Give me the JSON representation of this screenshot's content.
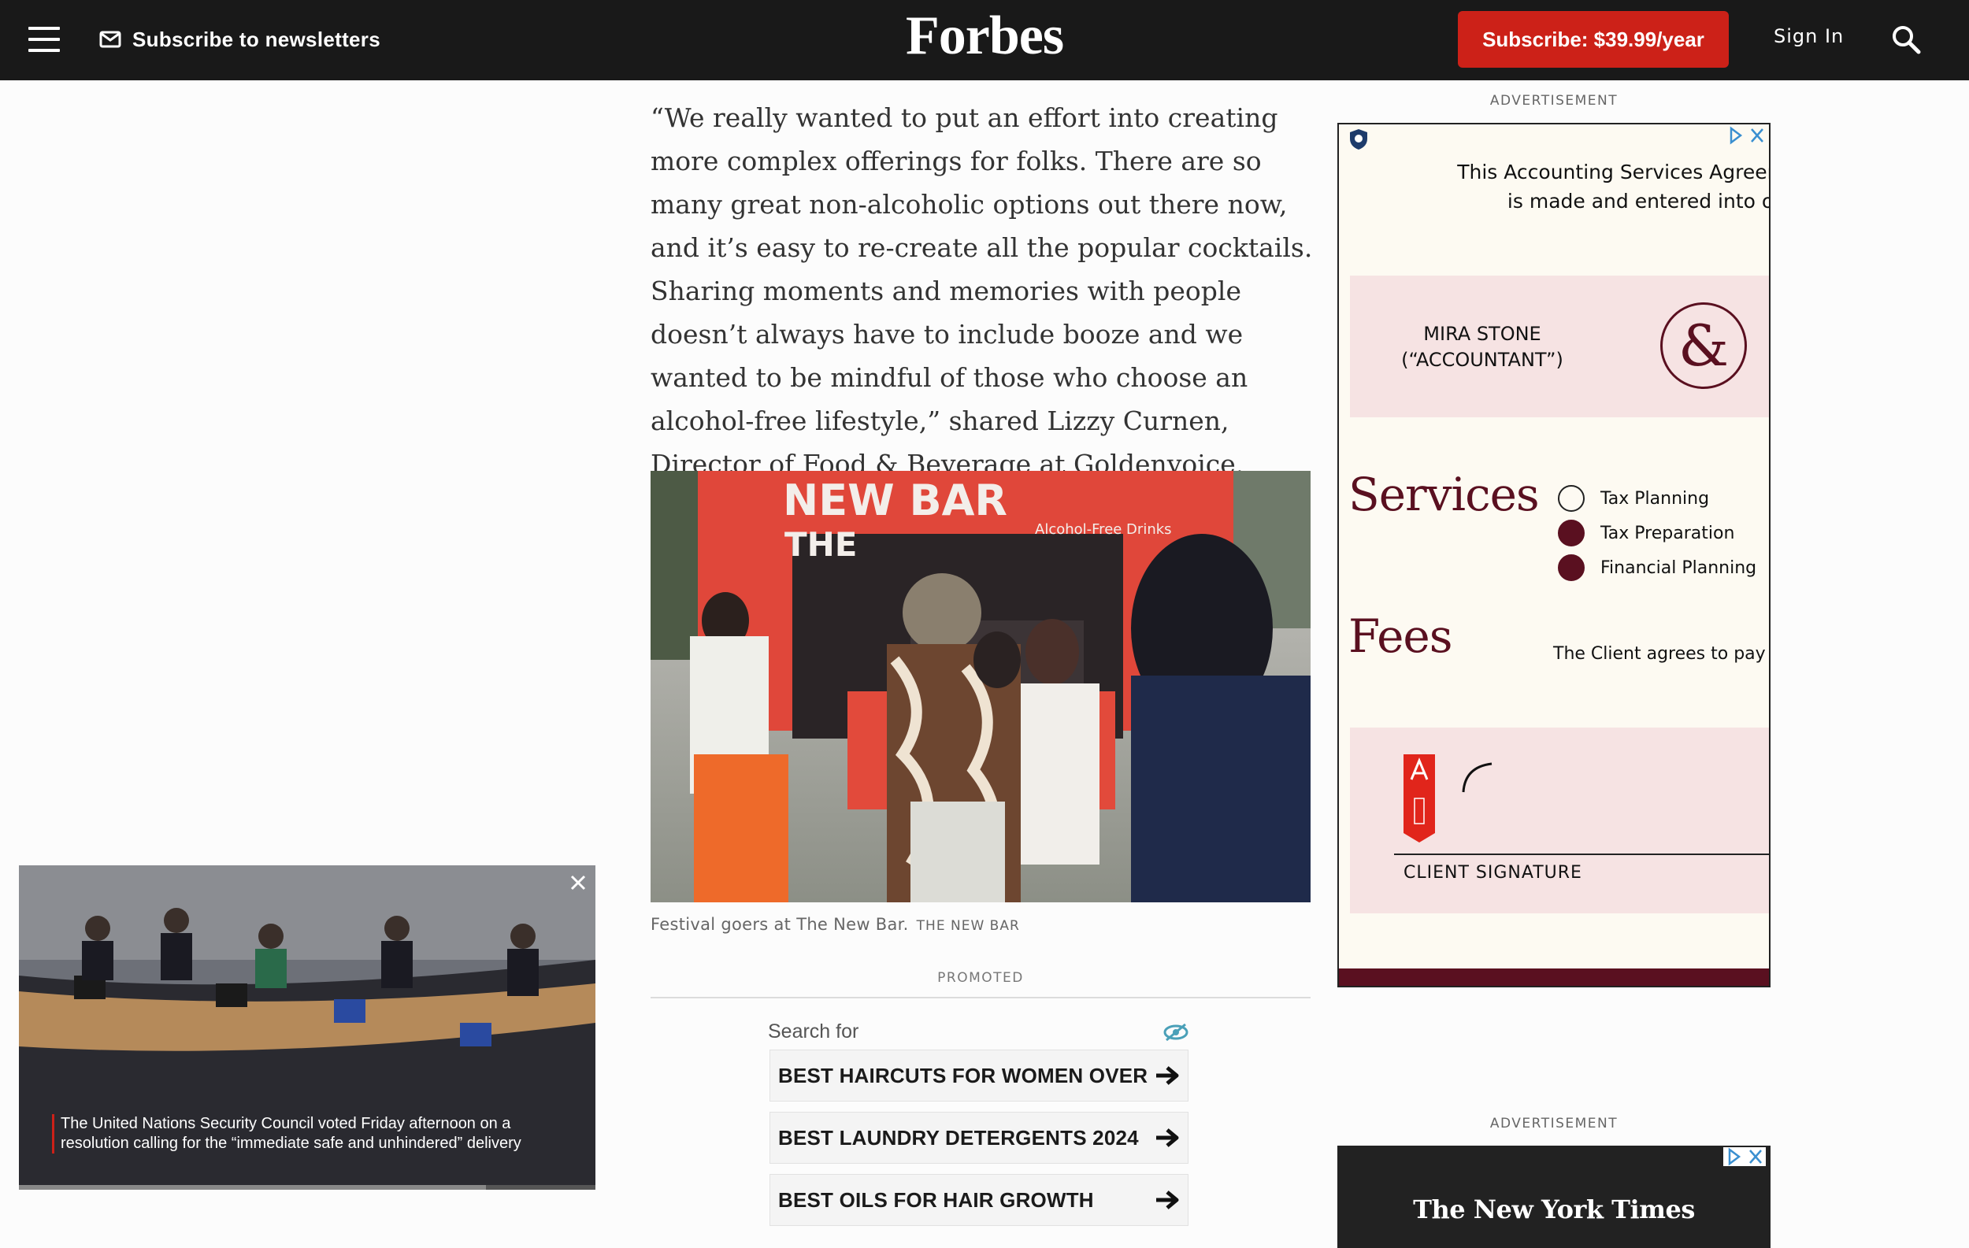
{
  "header": {
    "newsletter_label": "Subscribe to newsletters",
    "logo": "Forbes",
    "subscribe_label": "Subscribe: $39.99/year",
    "signin_label": "Sign In"
  },
  "article": {
    "quote": "“We really wanted to put an effort into creating more complex offerings for folks. There are so many great non-alcoholic options out there now, and it’s easy to re-create all the popular cocktails. Sharing moments and memories with people doesn’t always have to include booze and we wanted to be mindful of those who choose an alcohol-free lifestyle,” shared Lizzy Curnen, Director of Food & Beverage at Goldenvoice.",
    "photo": {
      "sign_the": "THE",
      "sign_newbar": "NEW BAR",
      "sign_alcohol_free": "Alcohol-Free Drinks"
    },
    "caption": "Festival goers at The New Bar.",
    "caption_credit": "THE NEW BAR"
  },
  "promoted": {
    "label": "PROMOTED",
    "search_for": "Search for",
    "rows": [
      "BEST HAIRCUTS FOR WOMEN OVER",
      "BEST LAUNDRY DETERGENTS 2024",
      "BEST OILS FOR HAIR GROWTH"
    ]
  },
  "video": {
    "caption": "The United Nations Security Council voted Friday afternoon on a resolution calling for the “immediate safe and unhindered” delivery",
    "progress": 0.81
  },
  "ads": {
    "label": "ADVERTISEMENT",
    "ad1": {
      "top_line_1": "This Accounting Services Agreem",
      "top_line_2": "is made and entered into on",
      "party": "MIRA STONE\n(“ACCOUNTANT”)",
      "services_heading": "Services",
      "services": [
        {
          "label": "Tax Planning",
          "checked": false
        },
        {
          "label": "Tax Preparation",
          "checked": true
        },
        {
          "label": "Financial Planning",
          "checked": true
        }
      ],
      "fees_heading": "Fees",
      "fees_text": "The Client agrees to pay th",
      "signature_label": "CLIENT SIGNATURE",
      "brand_color": "#5a1020"
    },
    "ad2": {
      "brand": "The New York Times"
    }
  },
  "colors": {
    "topbar": "#191919",
    "subscribe_button": "#cc2118"
  }
}
